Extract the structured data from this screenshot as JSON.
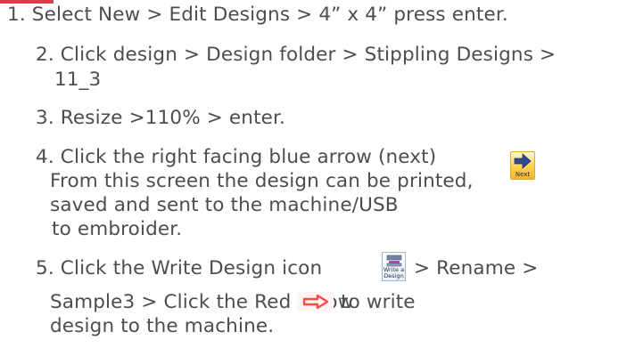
{
  "steps": [
    {
      "lines": [
        "1. Select New > Edit Designs > 4” x 4”  press enter."
      ]
    },
    {
      "lines": [
        "2. Click design > Design folder > Stippling Designs >",
        "11_3"
      ]
    },
    {
      "lines": [
        "3. Resize >110% > enter."
      ]
    },
    {
      "lines": [
        "4. Click the right facing blue arrow (next)",
        "From this screen the design can be printed,",
        "saved and sent to the machine/USB",
        "to embroider."
      ]
    },
    {
      "lines": [
        "5. Click the Write Design icon",
        "> Rename >",
        "Sample3 > Click the Red Arrow",
        "to write",
        "design to the machine."
      ]
    }
  ],
  "icons": {
    "next": {
      "name": "next-arrow-icon",
      "label": "Next",
      "color": "#2c4d94"
    },
    "write_design": {
      "name": "write-design-icon",
      "label_line1": "Write a",
      "label_line2": "Design"
    },
    "red_arrow": {
      "name": "red-arrow-icon",
      "color": "#ff4a4a"
    }
  },
  "colors": {
    "text": "#4d4d4f",
    "accent": "#d63f49"
  }
}
